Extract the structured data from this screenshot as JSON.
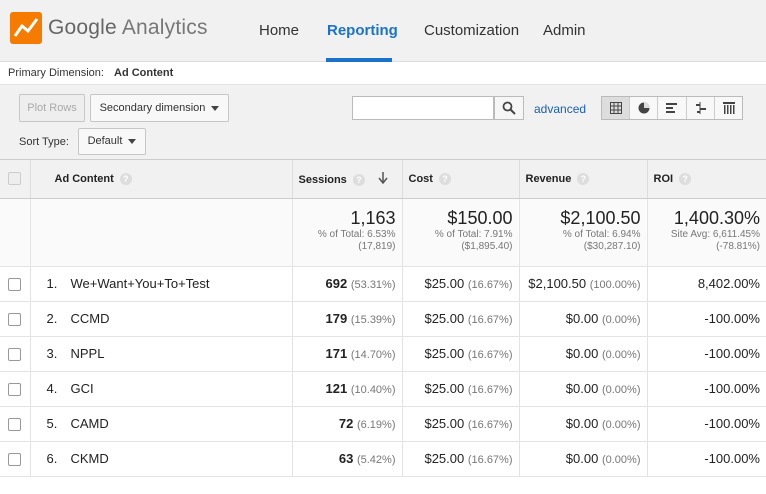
{
  "app": {
    "brand_google": "Google",
    "brand_product": "Analytics",
    "nav": [
      "Home",
      "Reporting",
      "Customization",
      "Admin"
    ]
  },
  "dimension": {
    "label": "Primary Dimension:",
    "value": "Ad Content"
  },
  "controls": {
    "plot_rows": "Plot Rows",
    "secondary_dimension": "Secondary dimension",
    "search_value": "",
    "advanced": "advanced",
    "sort_label": "Sort Type:",
    "sort_value": "Default"
  },
  "table": {
    "headers": [
      "Ad Content",
      "Sessions",
      "Cost",
      "Revenue",
      "ROI"
    ],
    "totals": {
      "sessions": {
        "value": "1,163",
        "line1": "% of Total: 6.53%",
        "line2": "(17,819)"
      },
      "cost": {
        "value": "$150.00",
        "line1": "% of Total: 7.91%",
        "line2": "($1,895.40)"
      },
      "revenue": {
        "value": "$2,100.50",
        "line1": "% of Total: 6.94%",
        "line2": "($30,287.10)"
      },
      "roi": {
        "value": "1,400.30%",
        "line1": "Site Avg: 6,611.45%",
        "line2": "(-78.81%)"
      }
    },
    "rows": [
      {
        "idx": "1.",
        "name": "We+Want+You+To+Test",
        "sessions": "692",
        "sessions_pct": "(53.31%)",
        "cost": "$25.00",
        "cost_pct": "(16.67%)",
        "revenue": "$2,100.50",
        "revenue_pct": "(100.00%)",
        "roi": "8,402.00%"
      },
      {
        "idx": "2.",
        "name": "CCMD",
        "sessions": "179",
        "sessions_pct": "(15.39%)",
        "cost": "$25.00",
        "cost_pct": "(16.67%)",
        "revenue": "$0.00",
        "revenue_pct": "(0.00%)",
        "roi": "-100.00%"
      },
      {
        "idx": "3.",
        "name": "NPPL",
        "sessions": "171",
        "sessions_pct": "(14.70%)",
        "cost": "$25.00",
        "cost_pct": "(16.67%)",
        "revenue": "$0.00",
        "revenue_pct": "(0.00%)",
        "roi": "-100.00%"
      },
      {
        "idx": "4.",
        "name": "GCI",
        "sessions": "121",
        "sessions_pct": "(10.40%)",
        "cost": "$25.00",
        "cost_pct": "(16.67%)",
        "revenue": "$0.00",
        "revenue_pct": "(0.00%)",
        "roi": "-100.00%"
      },
      {
        "idx": "5.",
        "name": "CAMD",
        "sessions": "72",
        "sessions_pct": "(6.19%)",
        "cost": "$25.00",
        "cost_pct": "(16.67%)",
        "revenue": "$0.00",
        "revenue_pct": "(0.00%)",
        "roi": "-100.00%"
      },
      {
        "idx": "6.",
        "name": "CKMD",
        "sessions": "63",
        "sessions_pct": "(5.42%)",
        "cost": "$25.00",
        "cost_pct": "(16.67%)",
        "revenue": "$0.00",
        "revenue_pct": "(0.00%)",
        "roi": "-100.00%"
      }
    ]
  },
  "colors": {
    "accent": "#1a73c8",
    "logo_orange": "#f57c00"
  },
  "icons": [
    "analytics-logo-icon",
    "search-icon",
    "sort-desc-icon",
    "help-icon",
    "table-view-icon",
    "pie-view-icon",
    "bar-view-icon",
    "comparison-view-icon",
    "pivot-view-icon"
  ]
}
